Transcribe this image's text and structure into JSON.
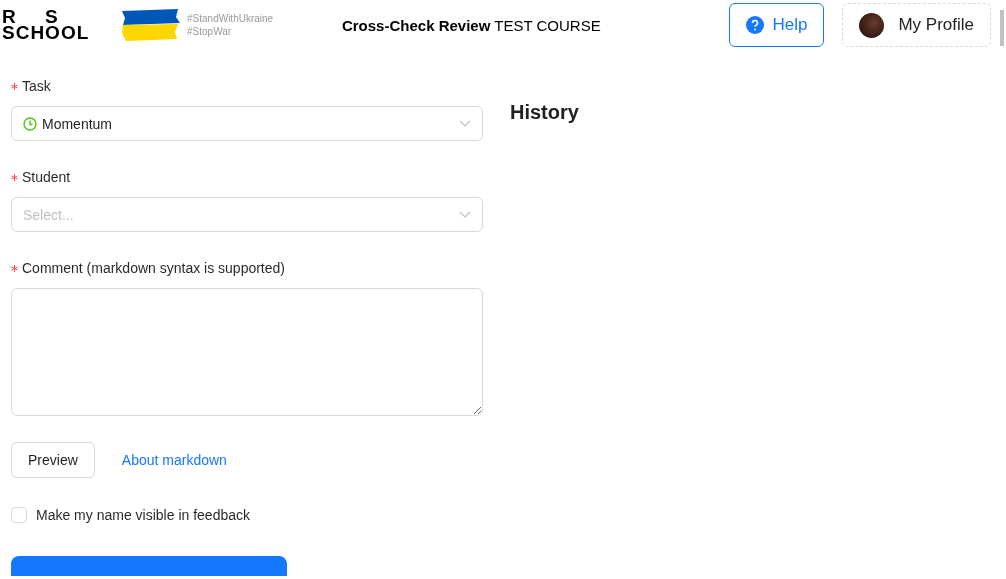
{
  "header": {
    "logo_top": "R S",
    "logo_bottom": "SCHOOL",
    "hashtags": [
      "#StandWithUkraine",
      "#StopWar"
    ],
    "title": "**Cross-Check Review** TEST COURSE",
    "help_button": "Help",
    "profile_button": "My Profile"
  },
  "form": {
    "fields": [
      {
        "kind": "select",
        "label": "Task",
        "required": true,
        "value": "Momentum"
      },
      {
        "kind": "select",
        "label": "Student",
        "required": true,
        "placeholder": "Select..."
      },
      {
        "kind": "textarea",
        "label": "Comment (markdown syntax is supported)",
        "required": true
      }
    ],
    "preview_button": "Preview",
    "markdown_link": "About markdown",
    "visible_name": {
      "label": "Make my name visible in feedback",
      "checked": false
    }
  },
  "history": {
    "title": "History"
  }
}
